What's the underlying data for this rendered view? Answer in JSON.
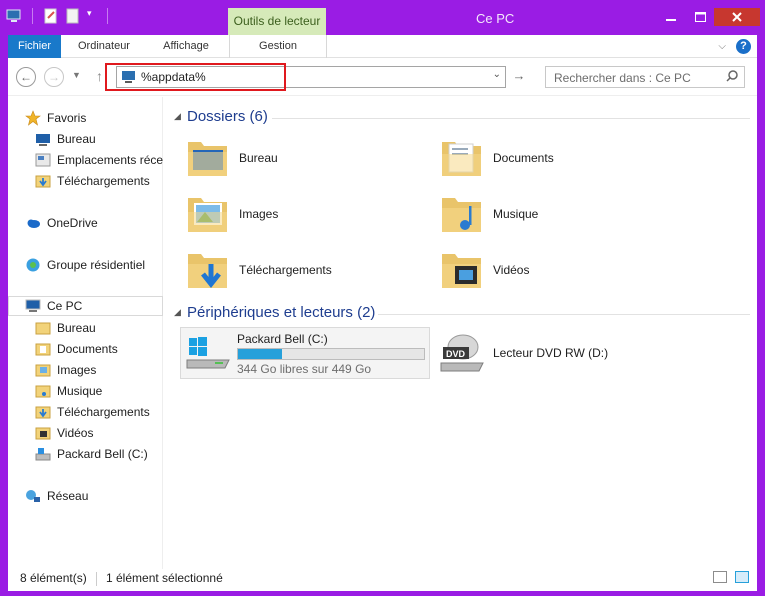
{
  "title_bar": {
    "title": "Ce PC",
    "context_tab": "Outils de lecteur"
  },
  "ribbon": {
    "tabs": [
      "Fichier",
      "Ordinateur",
      "Affichage",
      "Gestion"
    ],
    "help_label": "?"
  },
  "address": {
    "value": "%appdata%",
    "search_placeholder": "Rechercher dans : Ce PC"
  },
  "sidebar": {
    "favorites": "Favoris",
    "favorites_items": [
      "Bureau",
      "Emplacements récents",
      "Téléchargements"
    ],
    "onedrive": "OneDrive",
    "homegroup": "Groupe résidentiel",
    "this_pc": "Ce PC",
    "this_pc_items": [
      "Bureau",
      "Documents",
      "Images",
      "Musique",
      "Téléchargements",
      "Vidéos",
      "Packard Bell (C:)"
    ],
    "network": "Réseau"
  },
  "main": {
    "folders_group": "Dossiers (6)",
    "folders": [
      "Bureau",
      "Documents",
      "Images",
      "Musique",
      "Téléchargements",
      "Vidéos"
    ],
    "devices_group": "Périphériques et lecteurs (2)",
    "drive_c": {
      "name": "Packard Bell (C:)",
      "free_text": "344 Go libres sur 449 Go",
      "used_fraction": 0.234
    },
    "dvd": {
      "name": "Lecteur DVD RW (D:)",
      "icon_label": "DVD"
    }
  },
  "status": {
    "count": "8 élément(s)",
    "selection": "1 élément sélectionné"
  },
  "colors": {
    "window_frame": "#9a1ce4",
    "accent": "#1979ca",
    "highlight_box": "#e0191e",
    "progress": "#26a0da"
  }
}
